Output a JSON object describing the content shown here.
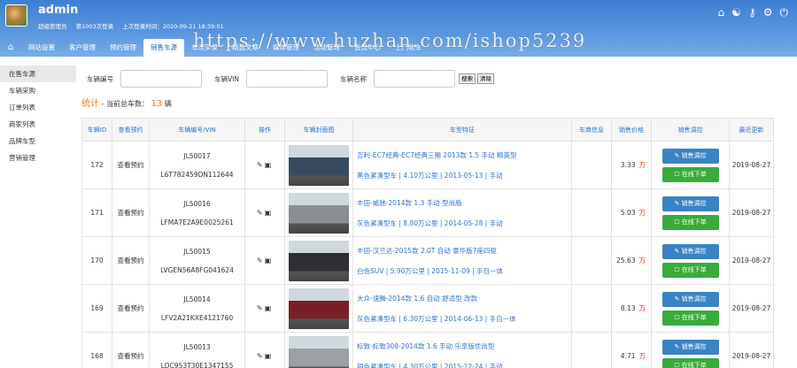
{
  "header": {
    "username": "admin",
    "info_role": "超级管理员",
    "info_login_count": "第1003次登录",
    "info_last_login": "上次登录时间：2020-09-21 18:39:01",
    "icons": [
      "home-icon",
      "palette-icon",
      "key-icon",
      "gear-icon",
      "power-icon"
    ]
  },
  "nav": {
    "home_icon": "⌂",
    "tabs": [
      "网站设置",
      "客户管理",
      "预约管理",
      "销售车源",
      "车况实录",
      "精选文章",
      "媒体管理",
      "活动管理",
      "会员中心",
      "上门收车"
    ],
    "active_index": 3
  },
  "watermark": "https://www.huzhan.com/ishop5239",
  "sidebar": {
    "items": [
      "在售车源",
      "车辆采购",
      "订单列表",
      "商家列表",
      "品牌车型",
      "营销管理"
    ],
    "active_index": 0
  },
  "filter": {
    "label_no": "车辆编号",
    "label_vin": "车辆VIN",
    "label_name": "车辆名称",
    "btn_search": "搜索",
    "btn_reset": "清除"
  },
  "stats": {
    "label": "统计",
    "text": "- 当前总车数：",
    "count": "13",
    "unit": "辆"
  },
  "table": {
    "headers": [
      "车辆ID",
      "查看预约",
      "车辆编号/VIN",
      "操作",
      "车辆封面图",
      "车型特征",
      "车商信息",
      "销售价格",
      "销售调控",
      "最近更新"
    ],
    "rows": [
      {
        "id": "172",
        "view": "查看预约",
        "no": "JL50017",
        "vin": "L6T782459DN112644",
        "title": "吉利-EC7经典-EC7经典三厢 2013款 1.5 手动 精英型",
        "spec": "黑色紧凑型车 | 4.10万公里 | 2013-05-13 | 手动",
        "price": "3.33",
        "unit": "万",
        "ctrl": "销售调控",
        "online": "在线下单",
        "date": "2019-08-27",
        "color": "#3a4a5e"
      },
      {
        "id": "171",
        "view": "查看预约",
        "no": "JL50016",
        "vin": "LFMA7E2A9E0025261",
        "title": "丰田-威驰-2014款 1.3 手动 型尚版",
        "spec": "灰色紧凑型车 | 8.80万公里 | 2014-05-28 | 手动",
        "price": "5.03",
        "unit": "万",
        "ctrl": "销售调控",
        "online": "在线下单",
        "date": "2019-08-27",
        "color": "#8a9092"
      },
      {
        "id": "170",
        "view": "查看预约",
        "no": "JL50015",
        "vin": "LVGEN56A8FG041624",
        "title": "丰田-汉兰达-2015款 2.0T 自动 豪华版7座四驱",
        "spec": "白色SUV | 5.90万公里 | 2015-11-09 | 手自一体",
        "price": "25.63",
        "unit": "万",
        "ctrl": "销售调控",
        "online": "在线下单",
        "date": "2019-08-27",
        "color": "#2d2f33"
      },
      {
        "id": "169",
        "view": "查看预约",
        "no": "JL50014",
        "vin": "LFV2A21KXE4121760",
        "title": "大众-速腾-2014款 1.6 自动 舒适型 改款",
        "spec": "灰色紧凑型车 | 6.30万公里 | 2014-06-13 | 手自一体",
        "price": "8.13",
        "unit": "万",
        "ctrl": "销售调控",
        "online": "在线下单",
        "date": "2019-08-27",
        "color": "#7a1f2a"
      },
      {
        "id": "168",
        "view": "查看预约",
        "no": "JL50013",
        "vin": "LDC953T30E1347155",
        "title": "标致-标致308-2014款 1.6 手动 乐享版优尚型",
        "spec": "银色紧凑型车 | 4.30万公里 | 2015-12-24 | 手动",
        "price": "4.71",
        "unit": "万",
        "ctrl": "销售调控",
        "online": "在线下单",
        "date": "2019-08-27",
        "color": "#9aa0a3"
      }
    ]
  }
}
